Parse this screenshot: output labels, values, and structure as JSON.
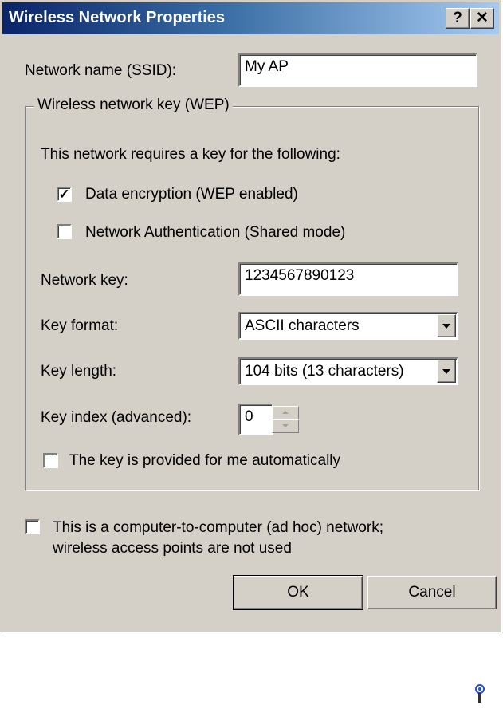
{
  "window": {
    "title": "Wireless Network Properties",
    "help_label": "?",
    "close_label": "✕"
  },
  "ssid": {
    "label": "Network name (SSID):",
    "value": "My AP"
  },
  "wep_group": {
    "legend": "Wireless network key (WEP)",
    "intro": "This network requires a key for the following:",
    "data_encryption": {
      "label": "Data encryption (WEP enabled)",
      "checked": true
    },
    "network_auth": {
      "label": "Network Authentication (Shared mode)",
      "checked": false
    },
    "network_key": {
      "label": "Network key:",
      "value": "1234567890123"
    },
    "key_format": {
      "label": "Key format:",
      "value": "ASCII characters"
    },
    "key_length": {
      "label": "Key length:",
      "value": "104 bits (13 characters)"
    },
    "key_index": {
      "label": "Key index (advanced):",
      "value": "0"
    },
    "auto_key": {
      "label": "The key is provided for me automatically",
      "checked": false
    }
  },
  "adhoc": {
    "line1": "This is a computer-to-computer (ad hoc) network;",
    "line2": "wireless access points are not used",
    "checked": false
  },
  "buttons": {
    "ok": "OK",
    "cancel": "Cancel"
  },
  "tray": {
    "icon": "wireless-network-icon"
  },
  "colors": {
    "dialog_bg": "#d4d0c8",
    "titlebar_start": "#0a246a",
    "titlebar_end": "#a6caf0"
  }
}
